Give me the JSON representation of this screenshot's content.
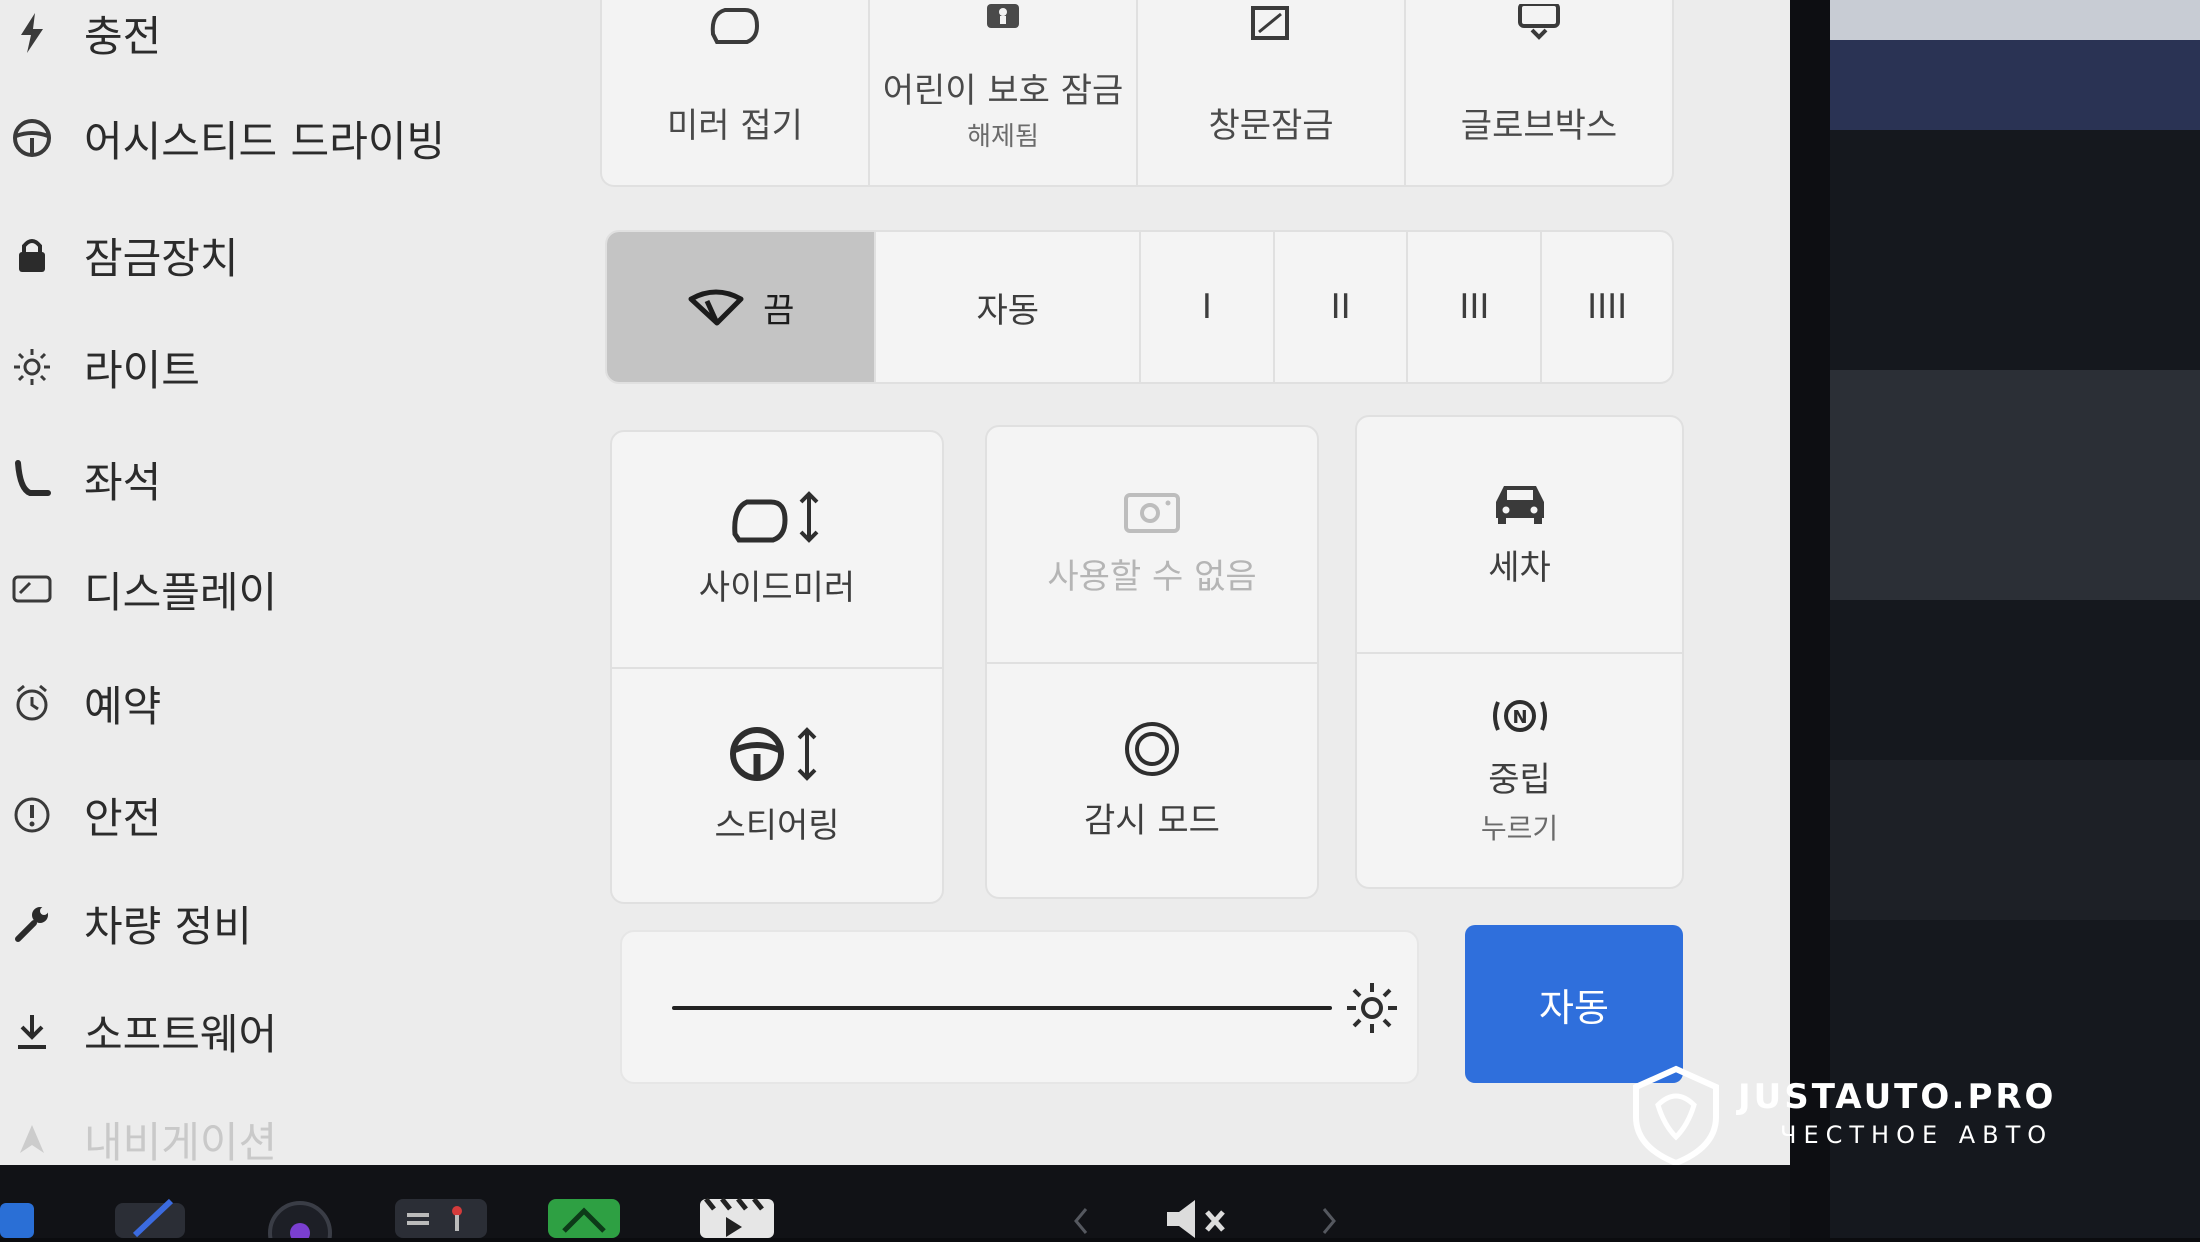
{
  "sidebar": {
    "items": [
      {
        "label": "충전",
        "icon": "bolt-icon"
      },
      {
        "label": "어시스티드 드라이빙",
        "icon": "steering-wheel-icon"
      },
      {
        "label": "잠금장치",
        "icon": "lock-icon"
      },
      {
        "label": "라이트",
        "icon": "sun-icon"
      },
      {
        "label": "좌석",
        "icon": "seat-icon"
      },
      {
        "label": "디스플레이",
        "icon": "display-icon"
      },
      {
        "label": "예약",
        "icon": "alarm-clock-icon"
      },
      {
        "label": "안전",
        "icon": "warning-circle-icon"
      },
      {
        "label": "차량 정비",
        "icon": "wrench-icon"
      },
      {
        "label": "소프트웨어",
        "icon": "download-icon"
      },
      {
        "label": "내비게이션",
        "icon": "navigation-arrow-icon"
      }
    ]
  },
  "top_tiles": [
    {
      "label": "미러 접기",
      "icon": "mirror-icon"
    },
    {
      "label": "어린이 보호 잠금",
      "sublabel": "해제됨",
      "icon": "child-lock-icon"
    },
    {
      "label": "창문잠금",
      "icon": "window-lock-icon"
    },
    {
      "label": "글로브박스",
      "icon": "glovebox-icon"
    }
  ],
  "wiper": {
    "segments": [
      {
        "label": "끔",
        "icon": "wiper-icon",
        "active": true
      },
      {
        "label": "자동",
        "active": false
      },
      {
        "label": "I",
        "active": false
      },
      {
        "label": "II",
        "active": false
      },
      {
        "label": "III",
        "active": false
      },
      {
        "label": "IIII",
        "active": false
      }
    ]
  },
  "controls": {
    "side_mirror": {
      "label": "사이드미러",
      "icon": "mirror-adjust-icon"
    },
    "steering": {
      "label": "스티어링",
      "icon": "steering-adjust-icon"
    },
    "unavailable": {
      "label": "사용할 수 없음",
      "icon": "camera-icon"
    },
    "sentry": {
      "label": "감시 모드",
      "icon": "sentry-icon"
    },
    "car_wash": {
      "label": "세차",
      "icon": "car-icon"
    },
    "neutral": {
      "label": "중립",
      "sublabel": "누르기",
      "icon": "neutral-icon"
    }
  },
  "brightness": {
    "level": 1.0,
    "auto_label": "자동",
    "accent": "#2f6fdc"
  },
  "watermark": {
    "title": "JUSTAUTO.PRO",
    "subtitle": "ЧЕСТНОЕ АВТО"
  }
}
